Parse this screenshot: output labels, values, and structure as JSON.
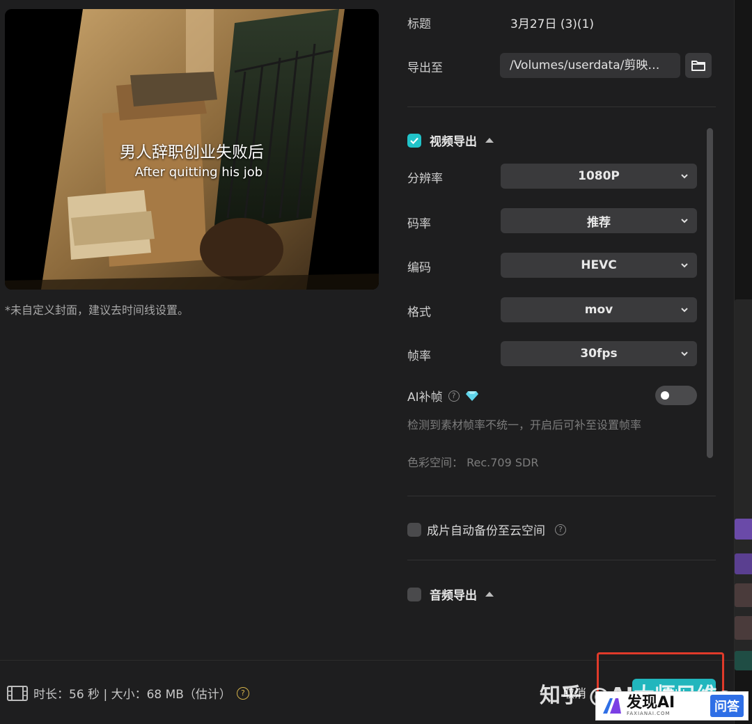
{
  "preview": {
    "caption_zh": "男人辞职创业失败后",
    "caption_en": "After quitting his job",
    "cover_note": "*未自定义封面，建议去时间线设置。"
  },
  "settings": {
    "title_label": "标题",
    "title_value": "3月27日 (3)(1)",
    "export_to_label": "导出至",
    "export_path": "/Volumes/userdata/剪映…"
  },
  "video_export": {
    "section_title": "视频导出",
    "checked": true,
    "resolution": {
      "label": "分辨率",
      "value": "1080P"
    },
    "bitrate": {
      "label": "码率",
      "value": "推荐"
    },
    "codec": {
      "label": "编码",
      "value": "HEVC"
    },
    "format": {
      "label": "格式",
      "value": "mov"
    },
    "framerate": {
      "label": "帧率",
      "value": "30fps"
    },
    "ai_frame": {
      "label": "AI补帧",
      "enabled": false
    },
    "hint": "检测到素材帧率不统一，开启后可补至设置帧率",
    "color_space": "色彩空间： Rec.709 SDR"
  },
  "cloud_backup": {
    "label": "成片自动备份至云空间",
    "checked": false
  },
  "audio_export": {
    "section_title": "音频导出",
    "checked": false
  },
  "footer": {
    "info": "时长：56 秒 | 大小：68 MB（估计）",
    "cancel_label": "取消",
    "export_label": "导出"
  },
  "watermark": {
    "text": "知乎 @AI大师兄维c",
    "logo_brand": "发现AI",
    "logo_sub": "FAXIANAI.COM",
    "logo_ask": "问答"
  },
  "colors": {
    "accent": "#21b6bd",
    "highlight_box": "#e03a2a",
    "background": "#1e1e1f"
  }
}
